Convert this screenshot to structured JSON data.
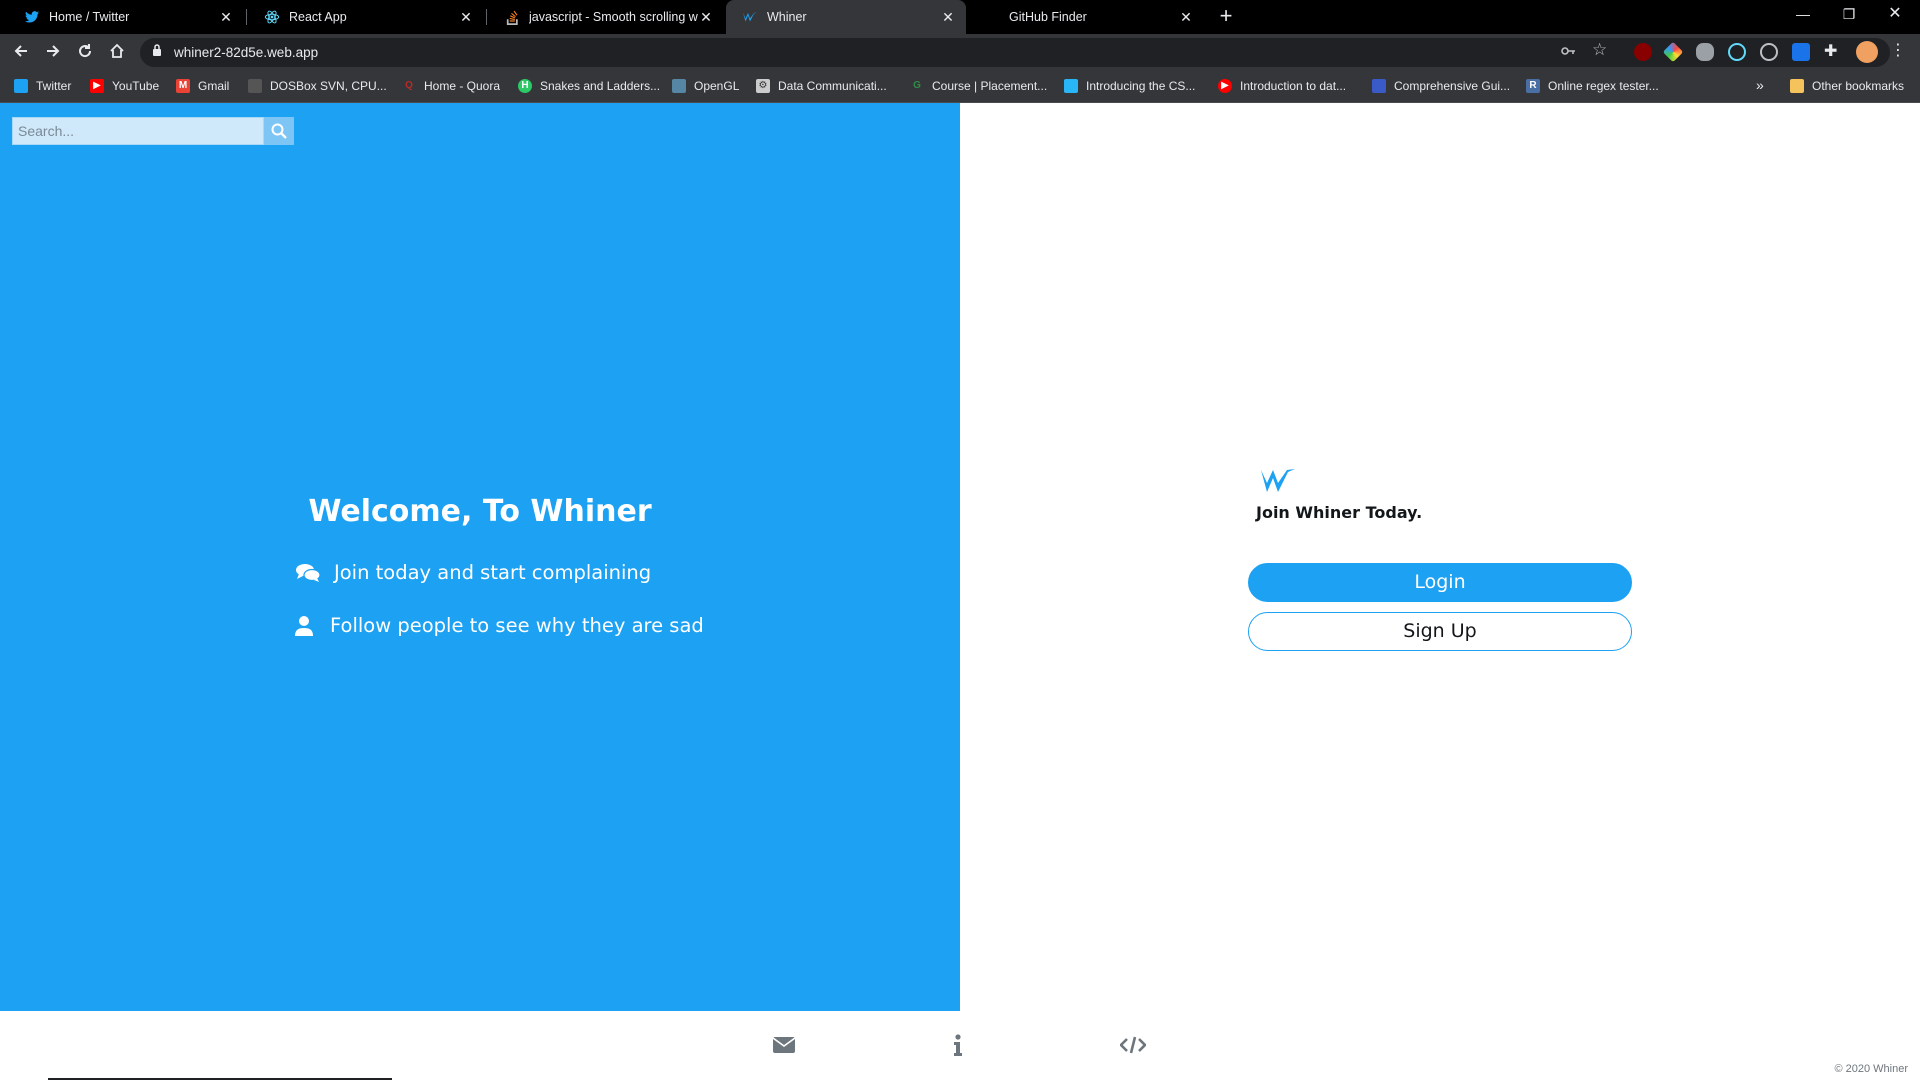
{
  "browser": {
    "tabs": [
      {
        "title": "Home / Twitter",
        "favicon": "twitter-bird-icon",
        "active": false
      },
      {
        "title": "React App",
        "favicon": "react-atom-icon",
        "active": false
      },
      {
        "title": "javascript - Smooth scrolling whe",
        "favicon": "stackoverflow-icon",
        "active": false
      },
      {
        "title": "Whiner",
        "favicon": "whiner-w-icon",
        "active": true
      },
      {
        "title": "GitHub Finder",
        "favicon": "blank-icon",
        "active": false
      }
    ],
    "url": "whiner2-82d5e.web.app",
    "bookmarks": [
      {
        "label": "Twitter",
        "icon": "twitter-bird-icon",
        "color": "#1da1f2"
      },
      {
        "label": "YouTube",
        "icon": "youtube-icon",
        "color": "#ff0000"
      },
      {
        "label": "Gmail",
        "icon": "gmail-icon",
        "color": "#ea4335"
      },
      {
        "label": "DOSBox SVN, CPU...",
        "icon": "dosbox-icon",
        "color": "#888888"
      },
      {
        "label": "Home - Quora",
        "icon": "quora-icon",
        "color": "#b92b27"
      },
      {
        "label": "Snakes and Ladders...",
        "icon": "hackerearth-icon",
        "color": "#2ec866"
      },
      {
        "label": "OpenGL",
        "icon": "opengl-icon",
        "color": "#5586a4"
      },
      {
        "label": "Data Communicati...",
        "icon": "gear-icon",
        "color": "#cccccc"
      },
      {
        "label": "Course | Placement...",
        "icon": "gfg-icon",
        "color": "#2f8d46"
      },
      {
        "label": "Introducing the CS...",
        "icon": "bookmark-icon",
        "color": "#29b6f6"
      },
      {
        "label": "Introduction to dat...",
        "icon": "youtube-icon",
        "color": "#ff0000"
      },
      {
        "label": "Comprehensive Gui...",
        "icon": "doc-icon",
        "color": "#3a5bc7"
      },
      {
        "label": "Online regex tester...",
        "icon": "regex-icon",
        "color": "#4a6fa5"
      }
    ],
    "other_bookmarks": "Other bookmarks"
  },
  "left": {
    "search_placeholder": "Search...",
    "welcome": "Welcome, To Whiner",
    "features": [
      {
        "icon": "comments-icon",
        "text": "Join today and start complaining"
      },
      {
        "icon": "user-icon",
        "text": "Follow people to see why they are sad"
      }
    ]
  },
  "right": {
    "tagline": "Join Whiner Today.",
    "login_label": "Login",
    "signup_label": "Sign Up"
  },
  "footer": {
    "icons": [
      "envelope-icon",
      "info-icon",
      "code-icon"
    ],
    "copyright": "© 2020 Whiner"
  },
  "colors": {
    "brand": "#1da1f2",
    "dark": "#14171a"
  }
}
